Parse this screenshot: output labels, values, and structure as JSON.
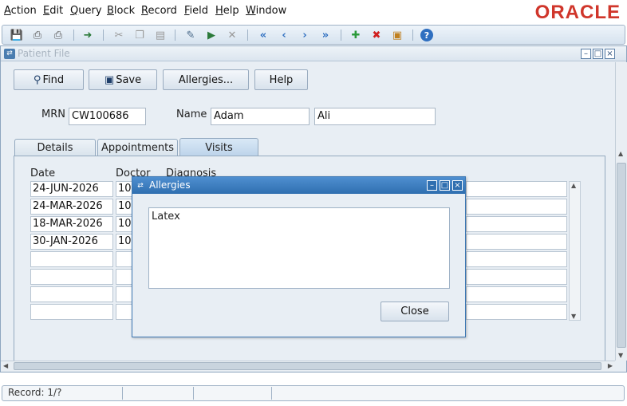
{
  "menu": {
    "items": [
      {
        "first": "A",
        "rest": "ction"
      },
      {
        "first": "E",
        "rest": "dit"
      },
      {
        "first": "Q",
        "rest": "uery"
      },
      {
        "first": "B",
        "rest": "lock"
      },
      {
        "first": "R",
        "rest": "ecord"
      },
      {
        "first": "F",
        "rest": "ield"
      },
      {
        "first": "H",
        "rest": "elp"
      },
      {
        "first": "W",
        "rest": "indow"
      }
    ],
    "brand": "ORACLE"
  },
  "toolbar": {
    "icons": [
      "save-icon",
      "print-icon",
      "print-setup-icon",
      "exit-icon",
      "cut-icon",
      "copy-icon",
      "paste-icon",
      "enter-query-icon",
      "execute-query-icon",
      "cancel-query-icon",
      "first-record-icon",
      "previous-record-icon",
      "next-record-icon",
      "last-record-icon",
      "insert-record-icon",
      "delete-record-icon",
      "lock-record-icon",
      "help-icon"
    ]
  },
  "window": {
    "title": "Patient File",
    "buttons": {
      "find": "Find",
      "save": "Save",
      "allergies": "Allergies...",
      "help": "Help"
    },
    "mrn_label": "MRN",
    "mrn_value": "CW100686",
    "name_label": "Name",
    "first_name": "Adam",
    "last_name": "Ali",
    "tabs": [
      "Details",
      "Appointments",
      "Visits"
    ],
    "active_tab": "Visits",
    "grid": {
      "headers": {
        "date": "Date",
        "doctor": "Doctor",
        "diagnosis": "Diagnosis"
      },
      "rows": [
        {
          "date": "24-JUN-2026",
          "doctor": "10"
        },
        {
          "date": "24-MAR-2026",
          "doctor": "10"
        },
        {
          "date": "18-MAR-2026",
          "doctor": "10"
        },
        {
          "date": "30-JAN-2026",
          "doctor": "10"
        },
        {
          "date": "",
          "doctor": ""
        },
        {
          "date": "",
          "doctor": ""
        },
        {
          "date": "",
          "doctor": ""
        },
        {
          "date": "",
          "doctor": ""
        }
      ]
    }
  },
  "status": {
    "record": "Record: 1/?"
  },
  "dialog": {
    "title": "Allergies",
    "text": "Latex",
    "close_label": "Close"
  }
}
